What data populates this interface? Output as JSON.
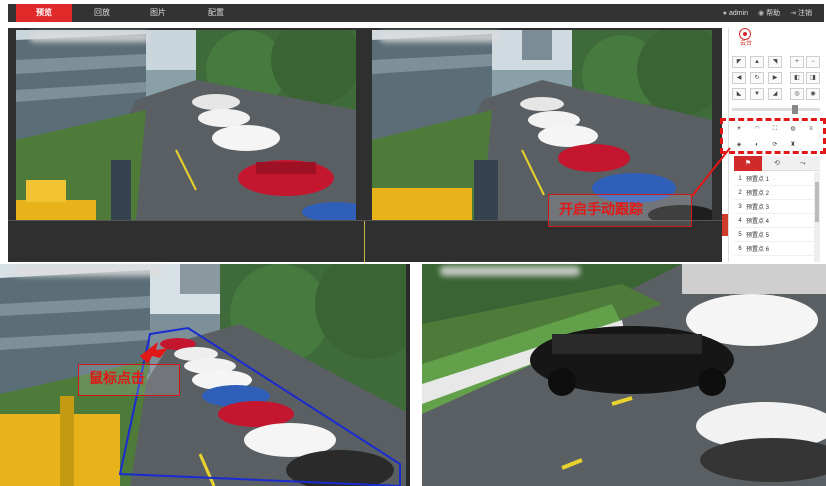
{
  "nav": {
    "tabs": [
      {
        "label": "预览",
        "active": true
      },
      {
        "label": "回放",
        "active": false
      },
      {
        "label": "图片",
        "active": false
      },
      {
        "label": "配置",
        "active": false
      }
    ],
    "user": "admin",
    "help": "帮助",
    "logout": "注销"
  },
  "ptz": {
    "title": "云台",
    "presets": [
      {
        "num": "1",
        "label": "预置点 1"
      },
      {
        "num": "2",
        "label": "预置点 2"
      },
      {
        "num": "3",
        "label": "预置点 3"
      },
      {
        "num": "4",
        "label": "预置点 4"
      },
      {
        "num": "5",
        "label": "预置点 5"
      },
      {
        "num": "6",
        "label": "预置点 6"
      }
    ]
  },
  "annotations": {
    "manual_tracking": "开启手动跟踪",
    "mouse_click": "鼠标点击"
  },
  "icons": {
    "user": "user-icon",
    "help": "help-icon",
    "logout": "logout-icon",
    "ptz": "target-icon",
    "flag": "flag-icon"
  },
  "colors": {
    "accent": "#e02a2a",
    "topbar": "#333333",
    "annotation": "#e01818",
    "tracking_box": "#1a2bd0"
  }
}
